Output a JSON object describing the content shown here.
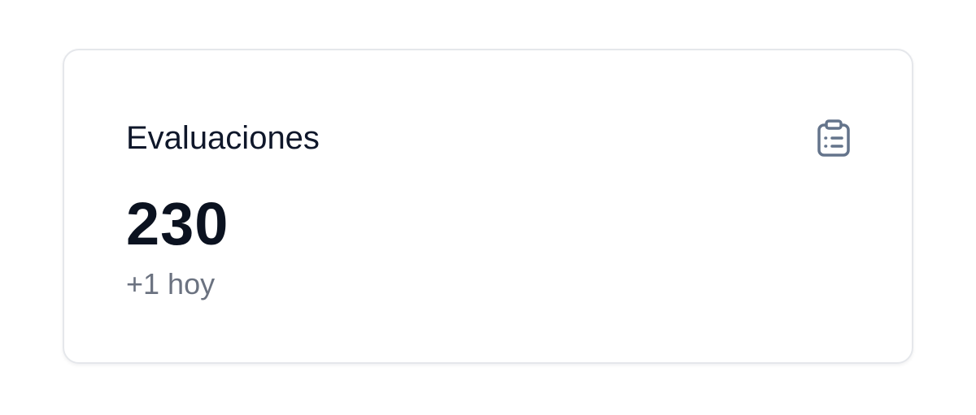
{
  "card": {
    "title": "Evaluaciones",
    "value": "230",
    "subtitle": "+1 hoy",
    "icon": "clipboard-list-icon"
  },
  "colors": {
    "title": "#0f172a",
    "value": "#0b1220",
    "subtitle": "#6b7280",
    "icon": "#64748b",
    "border": "#e5e7eb"
  }
}
